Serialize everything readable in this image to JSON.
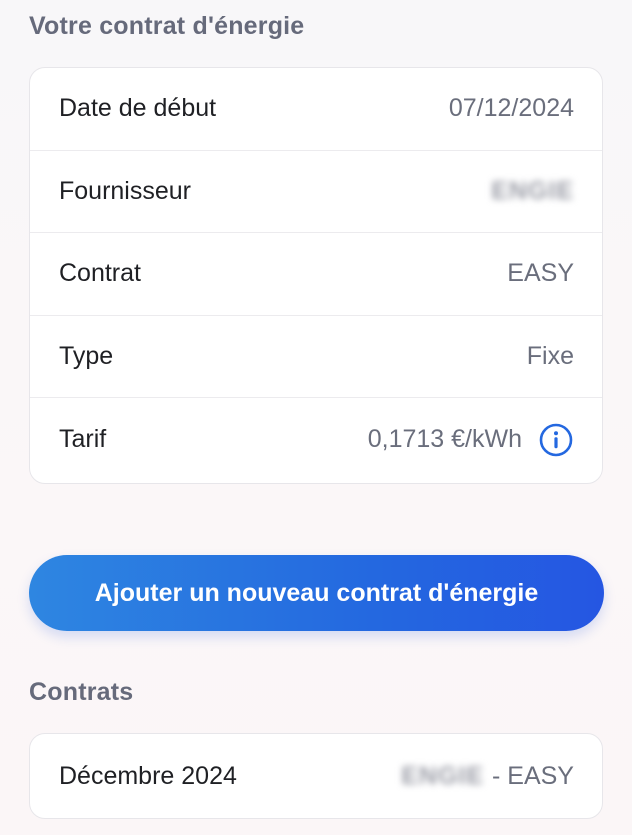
{
  "section_current": {
    "title": "Votre contrat d'énergie",
    "rows": [
      {
        "label": "Date de début",
        "value": "07/12/2024"
      },
      {
        "label": "Fournisseur",
        "value": "ENGIE"
      },
      {
        "label": "Contrat",
        "value": "EASY"
      },
      {
        "label": "Type",
        "value": "Fixe"
      },
      {
        "label": "Tarif",
        "value": "0,1713 €/kWh"
      }
    ],
    "info_icon": "info-icon"
  },
  "add_button": {
    "label": "Ajouter un nouveau contrat d'énergie"
  },
  "section_history": {
    "title": "Contrats",
    "items": [
      {
        "label": "Décembre 2024",
        "supplier": "ENGIE",
        "contract": "- EASY"
      }
    ]
  },
  "colors": {
    "accent": "#2468e0",
    "title_gray": "#666a7b",
    "value_gray": "#6a6e7c",
    "text": "#1f2024"
  }
}
